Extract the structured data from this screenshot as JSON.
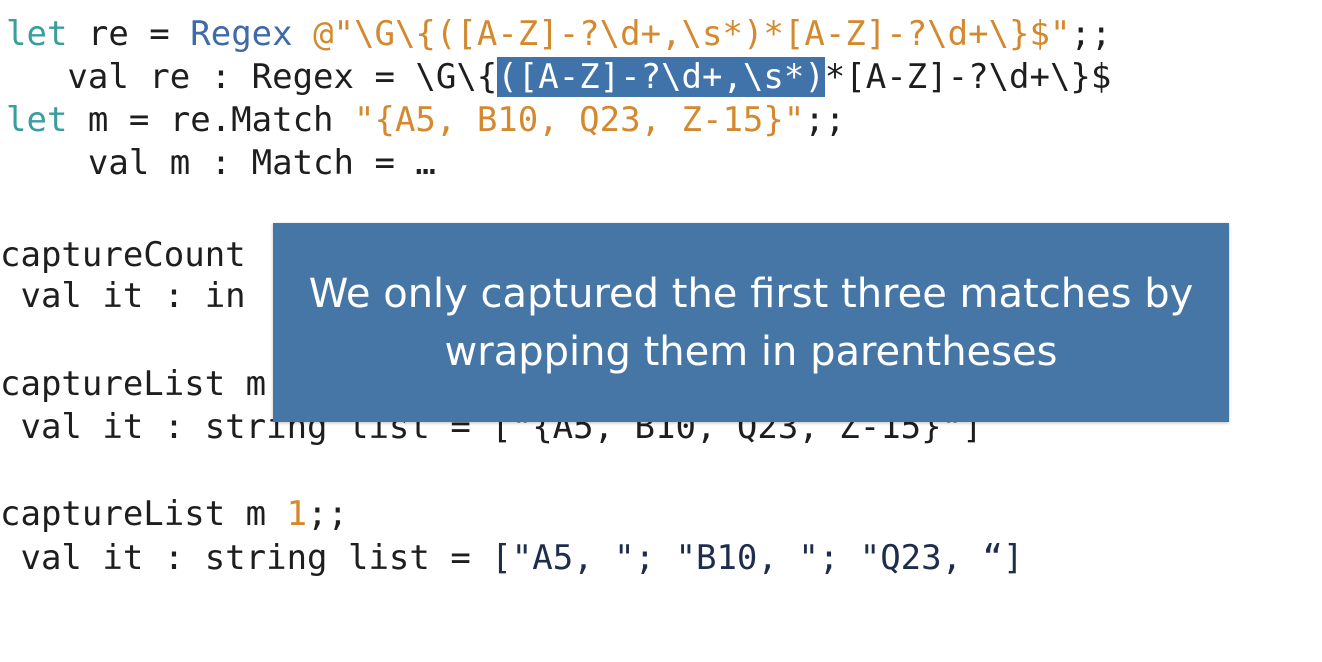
{
  "code": {
    "line1": {
      "kw": "let",
      "name": " re = ",
      "type": "Regex",
      "str": " @\"\\G\\{([A-Z]-?\\d+,\\s*)*[A-Z]-?\\d+\\}$\"",
      "end": ";;"
    },
    "line2": {
      "prefix": "   val re : Regex = \\G\\{",
      "highlight": "([A-Z]-?\\d+,\\s*)",
      "suffix": "*[A-Z]-?\\d+\\}$"
    },
    "line3": {
      "kw": "let",
      "name": " m = re.Match ",
      "str": "\"{A5, B10, Q23, Z-15}\"",
      "end": ";;"
    },
    "line4": {
      "text": "    val m : Match = …"
    },
    "line5": {
      "text": "captureCount"
    },
    "line6": {
      "text": " val it : in"
    },
    "line7": {
      "text": "captureList m"
    },
    "line8": {
      "text": " val it : string list = [\"{A5, B10, Q23, Z-15}\"]"
    },
    "line9": {
      "name": "captureList m ",
      "num": "1",
      "end": ";;"
    },
    "line10": {
      "prefix": " val it : string list = ",
      "value": "[\"A5, \"; \"B10, \"; \"Q23, “]"
    }
  },
  "callout": {
    "text": "We only captured the first three matches by wrapping them in parentheses"
  }
}
